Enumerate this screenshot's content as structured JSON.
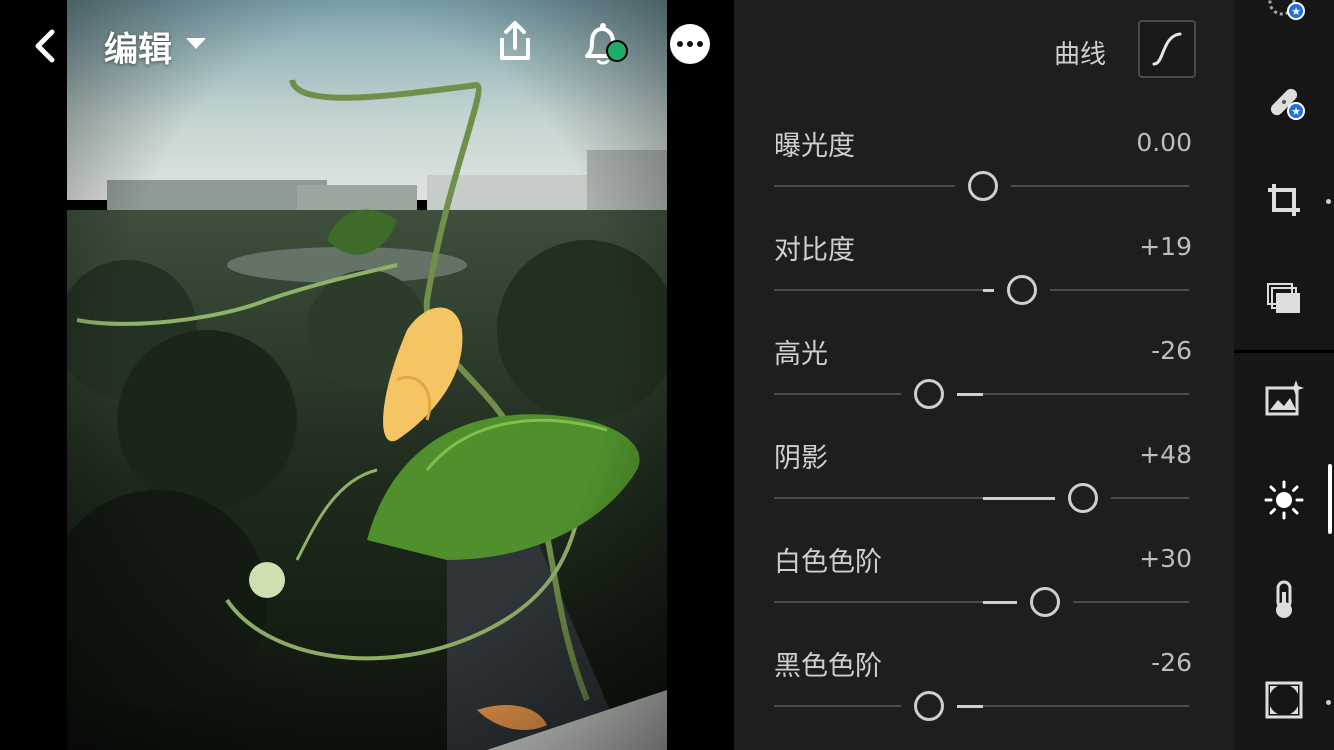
{
  "header": {
    "title": "编辑"
  },
  "curve": {
    "label": "曲线"
  },
  "sliders": [
    {
      "label": "曝光度",
      "value": "0.00",
      "level": 0
    },
    {
      "label": "对比度",
      "value": "+19",
      "level": 19
    },
    {
      "label": "高光",
      "value": "-26",
      "level": -26
    },
    {
      "label": "阴影",
      "value": "+48",
      "level": 48
    },
    {
      "label": "白色色阶",
      "value": "+30",
      "level": 30
    },
    {
      "label": "黑色色阶",
      "value": "-26",
      "level": -26
    }
  ],
  "toolbar": {
    "items": [
      "selective-mask-icon",
      "healing-icon",
      "crop-icon",
      "presets-icon",
      "auto-icon",
      "light-icon",
      "color-temperature-icon",
      "vignette-icon"
    ],
    "active": "light-icon"
  },
  "colors": {
    "accent_badge": "#1f6fe0",
    "notification_dot": "#1cae69",
    "panel_bg": "#1e1e1e"
  }
}
